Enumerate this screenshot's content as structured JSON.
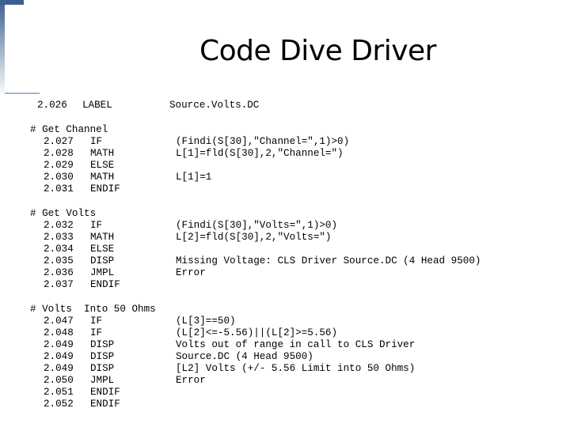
{
  "title": "Code Dive Driver",
  "header": {
    "line_no": "2.026",
    "keyword": "LABEL",
    "operand": "Source.Volts.DC"
  },
  "sections": [
    {
      "comment": "# Get Channel",
      "lines": [
        {
          "no": "2.027",
          "kw": "IF",
          "op": "(Findi(S[30],\"Channel=\",1)>0)"
        },
        {
          "no": "2.028",
          "kw": "MATH",
          "op": "L[1]=fld(S[30],2,\"Channel=\")"
        },
        {
          "no": "2.029",
          "kw": "ELSE",
          "op": ""
        },
        {
          "no": "2.030",
          "kw": "MATH",
          "op": "L[1]=1"
        },
        {
          "no": "2.031",
          "kw": "ENDIF",
          "op": ""
        }
      ]
    },
    {
      "comment": "# Get Volts",
      "lines": [
        {
          "no": "2.032",
          "kw": "IF",
          "op": "(Findi(S[30],\"Volts=\",1)>0)"
        },
        {
          "no": "2.033",
          "kw": "MATH",
          "op": "L[2]=fld(S[30],2,\"Volts=\")"
        },
        {
          "no": "2.034",
          "kw": "ELSE",
          "op": ""
        },
        {
          "no": "2.035",
          "kw": "DISP",
          "op": "Missing Voltage: CLS Driver Source.DC (4 Head 9500)"
        },
        {
          "no": "2.036",
          "kw": "JMPL",
          "op": "Error"
        },
        {
          "no": "2.037",
          "kw": "ENDIF",
          "op": ""
        }
      ]
    },
    {
      "comment": "# Volts  Into 50 Ohms",
      "lines": [
        {
          "no": "2.047",
          "kw": "IF",
          "op": "(L[3]==50)"
        },
        {
          "no": "2.048",
          "kw": "IF",
          "op": "(L[2]<=-5.56)||(L[2]>=5.56)"
        },
        {
          "no": "2.049",
          "kw": "DISP",
          "op": "Volts out of range in call to CLS Driver"
        },
        {
          "no": "2.049",
          "kw": "DISP",
          "op": "Source.DC (4 Head 9500)"
        },
        {
          "no": "2.049",
          "kw": "DISP",
          "op": "[L2] Volts (+/- 5.56 Limit into 50 Ohms)"
        },
        {
          "no": "2.050",
          "kw": "JMPL",
          "op": "Error"
        },
        {
          "no": "2.051",
          "kw": "ENDIF",
          "op": ""
        },
        {
          "no": "2.052",
          "kw": "ENDIF",
          "op": ""
        }
      ]
    }
  ]
}
